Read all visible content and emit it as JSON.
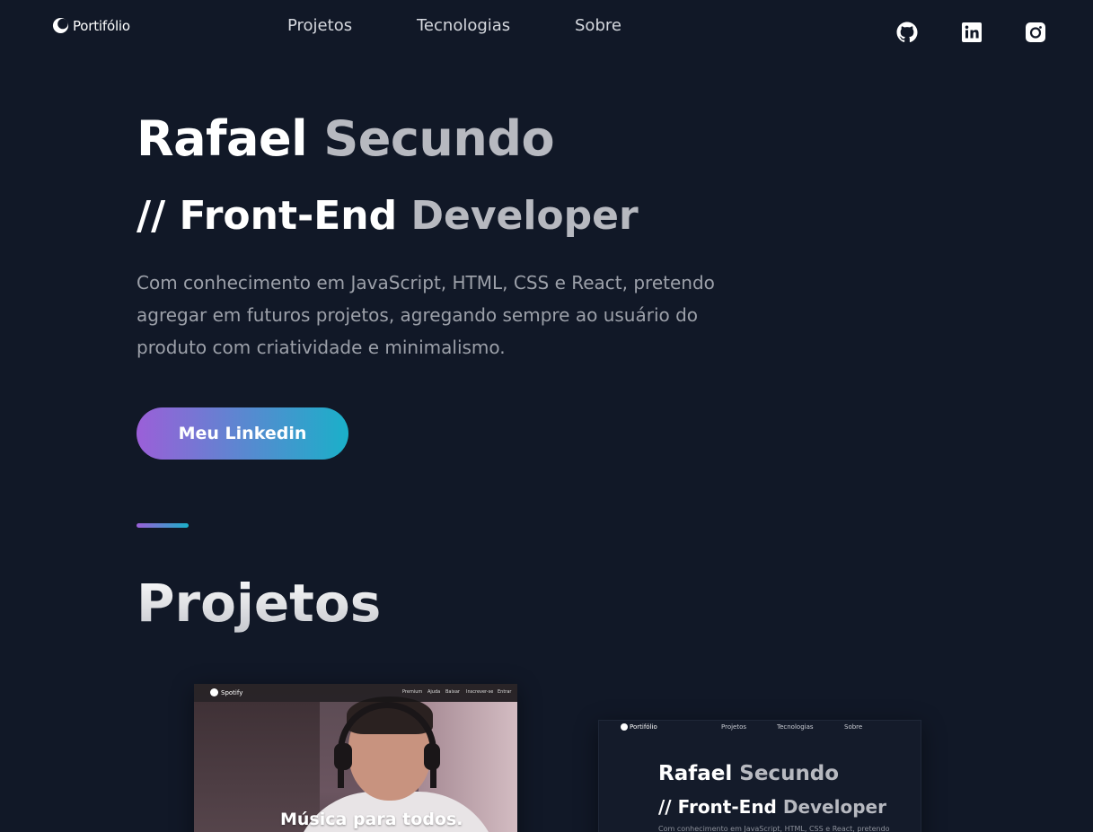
{
  "header": {
    "logo_text": "Portifólio",
    "nav": [
      {
        "label": "Projetos"
      },
      {
        "label": "Tecnologias"
      },
      {
        "label": "Sobre"
      }
    ],
    "social": [
      "github-icon",
      "linkedin-icon",
      "instagram-icon"
    ]
  },
  "hero": {
    "name_first": "Rafael",
    "name_last": "Secundo",
    "role_prefix": "// Front-End",
    "role_suffix": "Developer",
    "description": "Com conhecimento em JavaScript, HTML, CSS e React, pretendo agregar em futuros projetos, agregando sempre ao usuário do produto com criatividade e minimalismo.",
    "cta_label": "Meu Linkedin"
  },
  "projects": {
    "title": "Projetos",
    "spotify_card": {
      "brand": "Spotify",
      "menu": [
        "Premium",
        "Ajuda",
        "Baixar",
        "Inscrever-se",
        "Entrar"
      ],
      "headline": "Música para todos."
    },
    "portfolio_card": {
      "logo_text": "Portifólio",
      "nav": [
        "Projetos",
        "Tecnologias",
        "Sobre"
      ],
      "name_first": "Rafael",
      "name_last": "Secundo",
      "role_prefix": "// Front-End",
      "role_suffix": "Developer",
      "description_preview": "Com conhecimento em JavaScript, HTML, CSS e React, pretendo"
    }
  },
  "colors": {
    "background": "#111827",
    "gradient_start": "#9b5fd8",
    "gradient_end": "#1ab0c9",
    "muted_text": "#9ca0a9"
  }
}
